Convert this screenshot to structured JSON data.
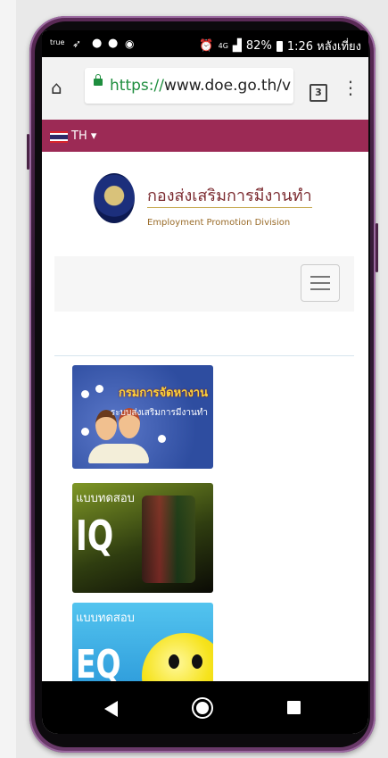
{
  "status_bar": {
    "carrier": "true",
    "battery": "82%",
    "time": "1:26 หลังเที่ยง",
    "network": "4G",
    "icons": [
      "location-arrow-icon",
      "line-icon",
      "line-icon",
      "chat-bubble-icon",
      "alarm-icon",
      "signal-icon",
      "battery-icon"
    ]
  },
  "browser": {
    "url_scheme": "https://",
    "url_rest": "www.doe.go.th/v",
    "tab_count": "3"
  },
  "language_bar": {
    "language": "TH",
    "caret": "▾"
  },
  "logo": {
    "title_th": "กองส่งเสริมการมีงานทำ",
    "title_en": "Employment Promotion Division"
  },
  "banners": [
    {
      "title": "กรมการจัดหางาน",
      "subtitle": "ระบบส่งเสริมการมีงานทำ"
    },
    {
      "label": "แบบทดสอบ",
      "big_text": "IQ"
    },
    {
      "label": "แบบทดสอบ",
      "big_text": "EQ"
    }
  ],
  "colors": {
    "language_bar": "#9c2a55",
    "url_lock": "#1e8e3e",
    "banner_blue": "#2e4da0",
    "banner_green": "#7f9726",
    "banner_sky": "#2592d6"
  }
}
